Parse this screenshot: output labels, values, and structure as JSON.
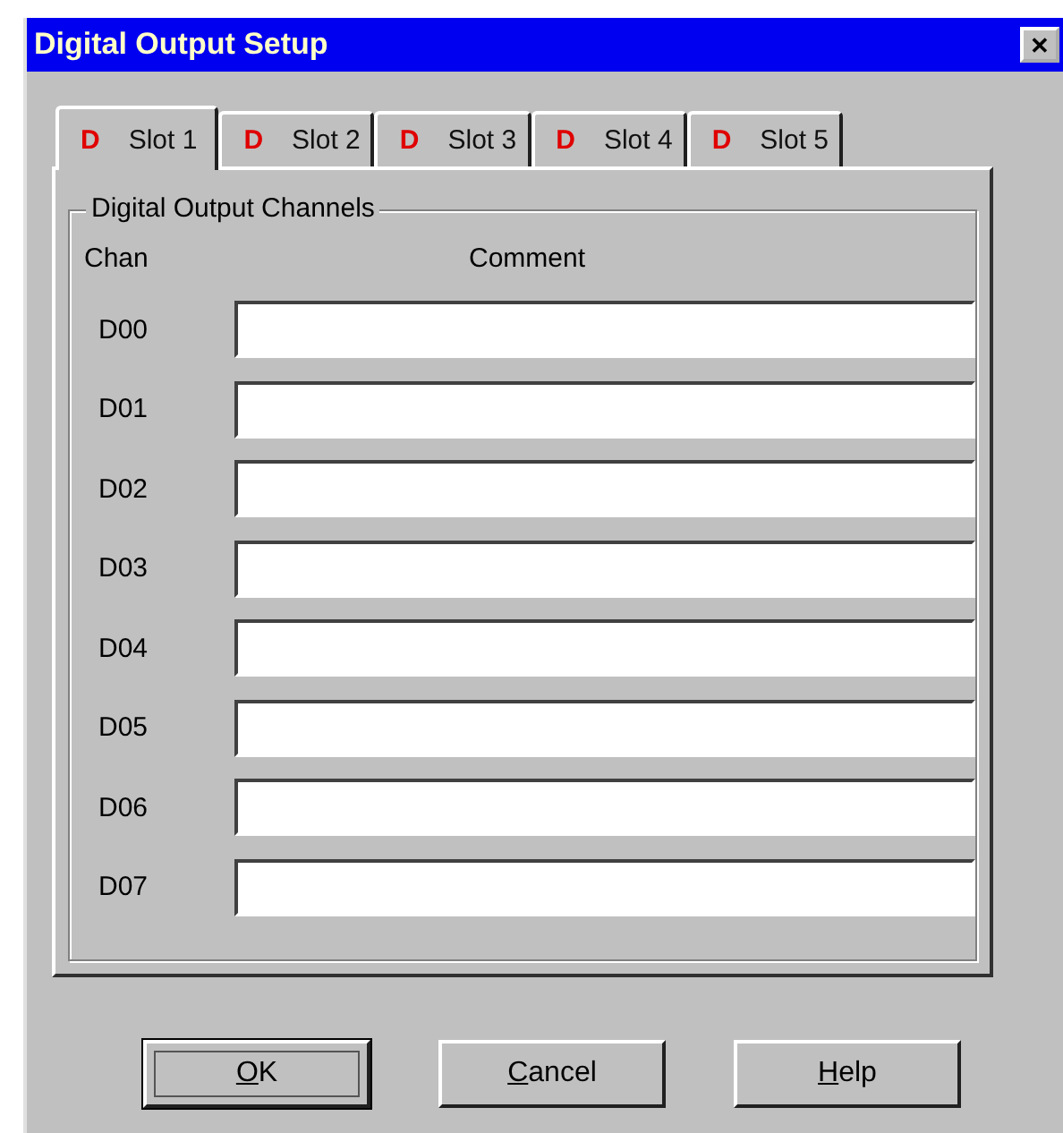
{
  "window": {
    "title": "Digital Output Setup",
    "close_label": "✕"
  },
  "tabs": [
    {
      "badge": "D",
      "label": "Slot 1",
      "selected": true
    },
    {
      "badge": "D",
      "label": "Slot 2",
      "selected": false
    },
    {
      "badge": "D",
      "label": "Slot 3",
      "selected": false
    },
    {
      "badge": "D",
      "label": "Slot 4",
      "selected": false
    },
    {
      "badge": "D",
      "label": "Slot 5",
      "selected": false
    }
  ],
  "group": {
    "title": "Digital Output Channels",
    "columns": [
      "Chan",
      "Comment"
    ],
    "channels": [
      {
        "chan": "D00"
      },
      {
        "chan": "D01"
      },
      {
        "chan": "D02"
      },
      {
        "chan": "D03"
      },
      {
        "chan": "D04"
      },
      {
        "chan": "D05"
      },
      {
        "chan": "D06"
      },
      {
        "chan": "D07"
      }
    ]
  },
  "buttons": [
    {
      "label": "OK",
      "default": true,
      "mnemonic_underlined": true
    },
    {
      "label": "Cancel",
      "default": false,
      "mnemonic_underlined": true
    },
    {
      "label": "Help",
      "default": false,
      "mnemonic_underlined": true
    }
  ]
}
